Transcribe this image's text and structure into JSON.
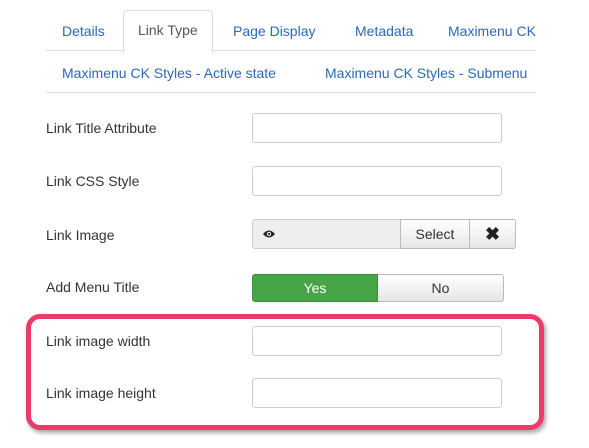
{
  "tabs": [
    {
      "label": "Details"
    },
    {
      "label": "Link Type",
      "active": true
    },
    {
      "label": "Page Display"
    },
    {
      "label": "Metadata"
    },
    {
      "label": "Maximenu CK"
    },
    {
      "label": "Maximenu CK Styles - Active state"
    },
    {
      "label": "Maximenu CK Styles - Submenu"
    }
  ],
  "form": {
    "link_title_attribute": {
      "label": "Link Title Attribute",
      "value": ""
    },
    "link_css_style": {
      "label": "Link CSS Style",
      "value": ""
    },
    "link_image": {
      "label": "Link Image",
      "preview_icon": "eye-icon",
      "select_label": "Select",
      "clear_icon": "close-icon"
    },
    "add_menu_title": {
      "label": "Add Menu Title",
      "yes_label": "Yes",
      "no_label": "No",
      "selected": "Yes"
    },
    "link_image_width": {
      "label": "Link image width",
      "value": ""
    },
    "link_image_height": {
      "label": "Link image height",
      "value": ""
    }
  },
  "colors": {
    "tab_link": "#2a69b8",
    "toggle_yes": "#46a546",
    "highlight": "#ec3b69"
  }
}
